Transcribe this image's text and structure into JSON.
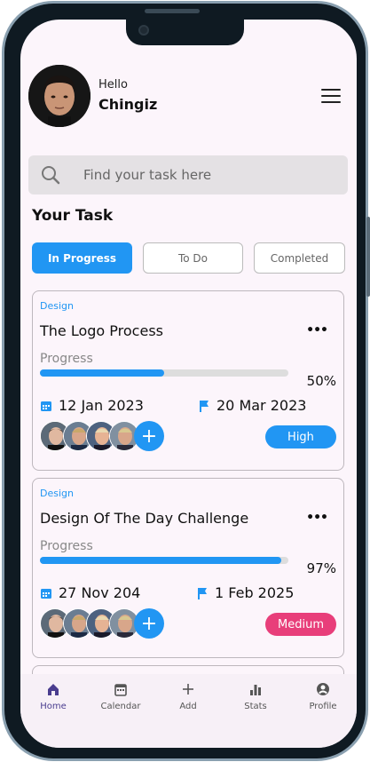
{
  "header": {
    "greeting": "Hello",
    "username": "Chingiz"
  },
  "search": {
    "placeholder": "Find your task here"
  },
  "section_title": "Your Task",
  "tabs": [
    {
      "label": "In Progress",
      "active": true
    },
    {
      "label": "To Do",
      "active": false
    },
    {
      "label": "Completed",
      "active": false
    }
  ],
  "tasks": [
    {
      "category": "Design",
      "title": "The Logo Process",
      "progress_label": "Progress",
      "progress": 50,
      "progress_text": "50%",
      "start_date": "12 Jan 2023",
      "end_date": "20 Mar 2023",
      "priority": "High",
      "priority_color": "#2196f3"
    },
    {
      "category": "Design",
      "title": "Design Of The Day Challenge",
      "progress_label": "Progress",
      "progress": 97,
      "progress_text": "97%",
      "start_date": "27 Nov 204",
      "end_date": "1 Feb 2025",
      "priority": "Medium",
      "priority_color": "#e83e7a"
    }
  ],
  "nav": [
    {
      "label": "Home",
      "icon": "home-icon",
      "active": true
    },
    {
      "label": "Calendar",
      "icon": "calendar-icon",
      "active": false
    },
    {
      "label": "Add",
      "icon": "add-icon",
      "active": false
    },
    {
      "label": "Stats",
      "icon": "stats-icon",
      "active": false
    },
    {
      "label": "Profile",
      "icon": "profile-icon",
      "active": false
    }
  ],
  "colors": {
    "accent": "#2196f3",
    "nav_active": "#4a3d8f",
    "background": "#fcf5fb"
  }
}
